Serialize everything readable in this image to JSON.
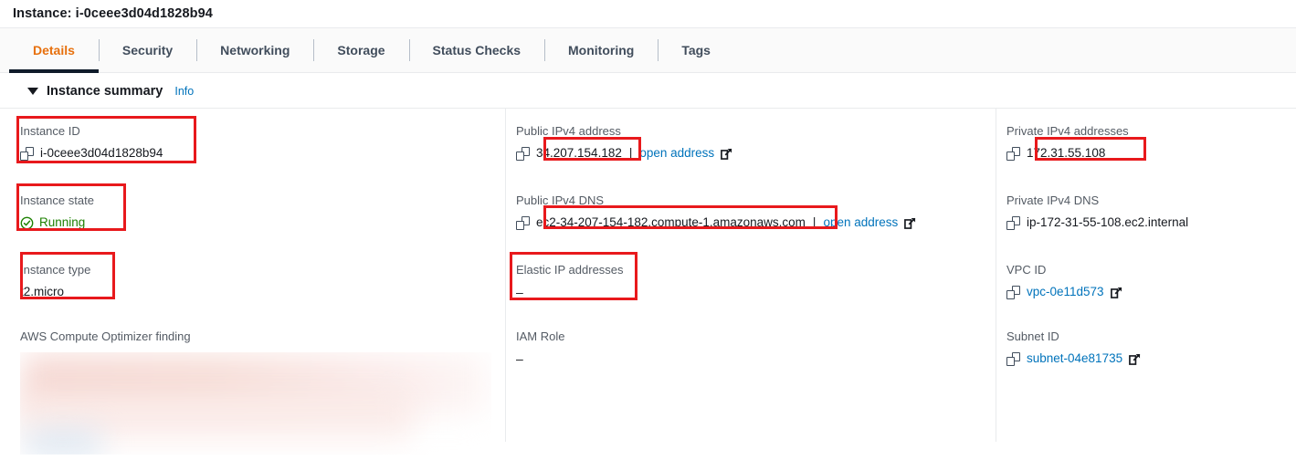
{
  "header": {
    "title": "Instance: i-0ceee3d04d1828b94"
  },
  "tabs": [
    {
      "label": "Details",
      "active": true
    },
    {
      "label": "Security",
      "active": false
    },
    {
      "label": "Networking",
      "active": false
    },
    {
      "label": "Storage",
      "active": false
    },
    {
      "label": "Status Checks",
      "active": false
    },
    {
      "label": "Monitoring",
      "active": false
    },
    {
      "label": "Tags",
      "active": false
    }
  ],
  "section": {
    "title": "Instance summary",
    "info_label": "Info",
    "caret": "caret-down-icon"
  },
  "fields": {
    "instance_id": {
      "label": "Instance ID",
      "value": "i-0ceee3d04d1828b94"
    },
    "instance_state": {
      "label": "Instance state",
      "value": "Running",
      "status_color": "#1d8102"
    },
    "instance_type": {
      "label": "Instance type",
      "value": "t2.micro"
    },
    "compute_optimizer": {
      "label": "AWS Compute Optimizer finding",
      "value": ""
    },
    "public_ipv4_address": {
      "label": "Public IPv4 address",
      "value": "34.207.154.182",
      "separator": "|",
      "open_label": "open address"
    },
    "public_ipv4_dns": {
      "label": "Public IPv4 DNS",
      "value": "ec2-34-207-154-182.compute-1.amazonaws.com",
      "separator": "|",
      "open_label": "open address"
    },
    "elastic_ip": {
      "label": "Elastic IP addresses",
      "value": "–"
    },
    "iam_role": {
      "label": "IAM Role",
      "value": "–"
    },
    "private_ipv4_addresses": {
      "label": "Private IPv4 addresses",
      "value": "172.31.55.108"
    },
    "private_ipv4_dns": {
      "label": "Private IPv4 DNS",
      "value": "ip-172-31-55-108.ec2.internal"
    },
    "vpc_id": {
      "label": "VPC ID",
      "value": "vpc-0e11d573"
    },
    "subnet_id": {
      "label": "Subnet ID",
      "value": "subnet-04e81735"
    }
  },
  "colors": {
    "annotation": "#e8191c",
    "accent": "#e7700d",
    "link": "#0073bb",
    "active_tab_underline": "#0f1b2a"
  }
}
